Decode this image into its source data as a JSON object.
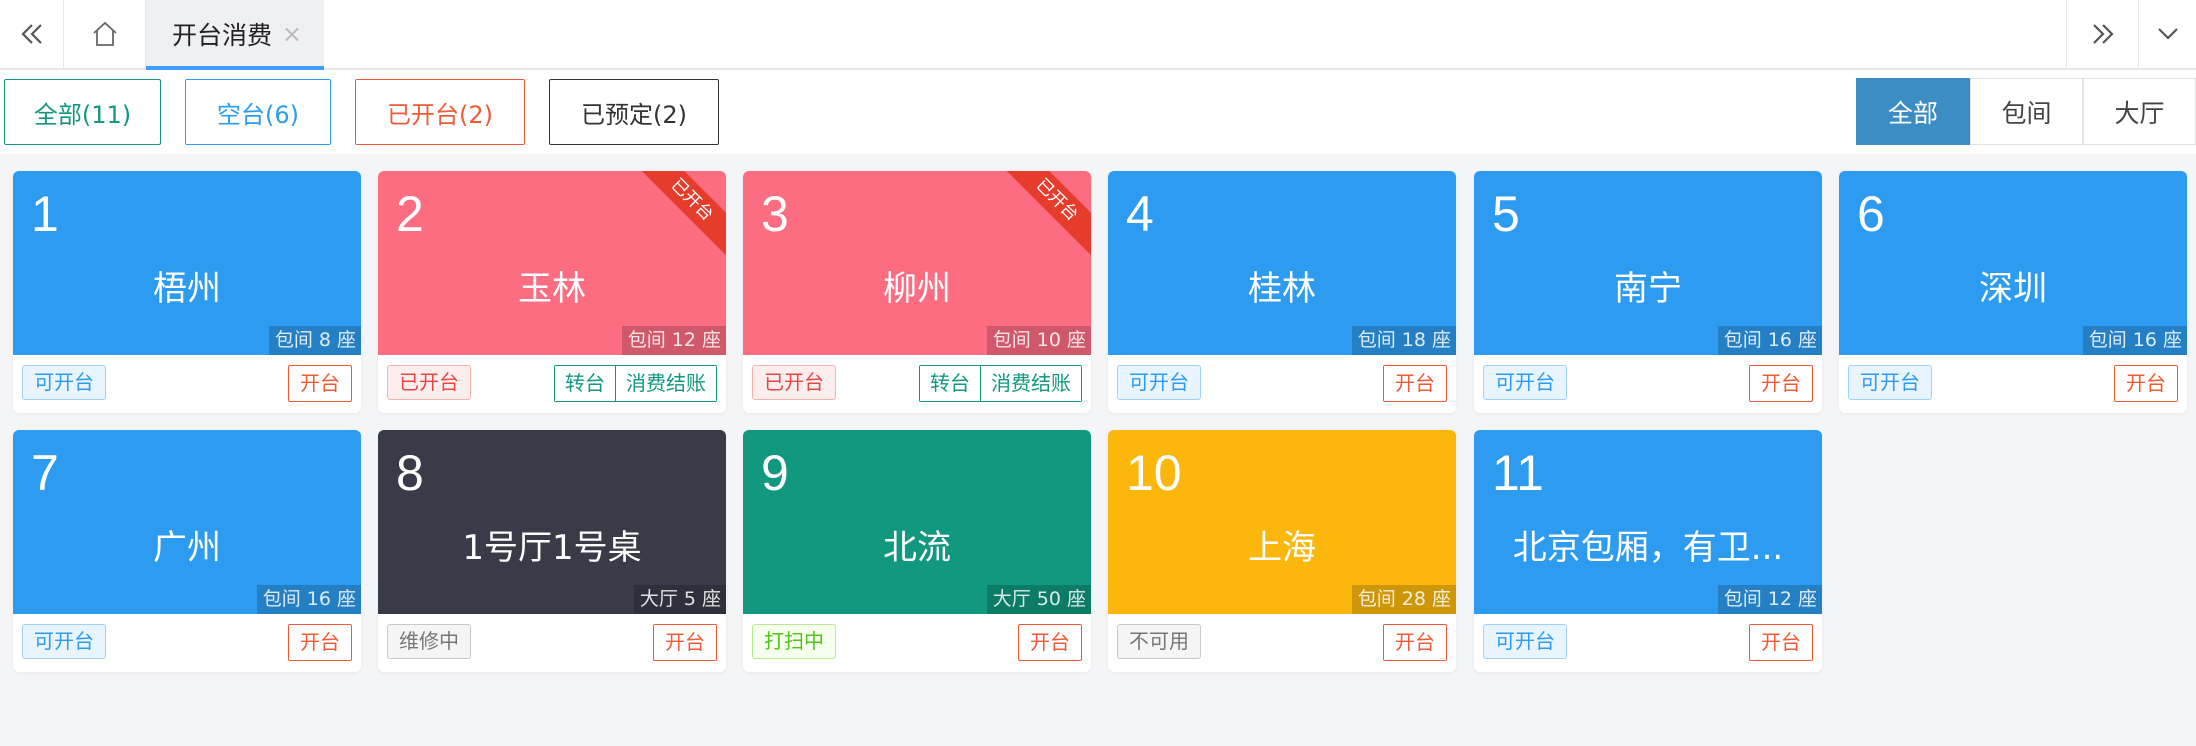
{
  "tabs": {
    "active_label": "开台消费",
    "close_symbol": "×"
  },
  "filters": [
    {
      "label": "全部(11)"
    },
    {
      "label": "空台(6)"
    },
    {
      "label": "已开台(2)"
    },
    {
      "label": "已预定(2)"
    }
  ],
  "segments": [
    {
      "label": "全部",
      "active": true
    },
    {
      "label": "包间",
      "active": false
    },
    {
      "label": "大厅",
      "active": false
    }
  ],
  "actions": {
    "open": "开台",
    "transfer": "转台",
    "checkout": "消费结账"
  },
  "ribbon_text": "已开台",
  "tables": [
    {
      "no": "1",
      "name": "梧州",
      "meta": "包间 8 座",
      "status": "可开台",
      "color": "#2d9bf0"
    },
    {
      "no": "2",
      "name": "玉林",
      "meta": "包间 12 座",
      "status": "已开台",
      "color": "#fd6d82"
    },
    {
      "no": "3",
      "name": "柳州",
      "meta": "包间 10 座",
      "status": "已开台",
      "color": "#fd6d82"
    },
    {
      "no": "4",
      "name": "桂林",
      "meta": "包间 18 座",
      "status": "可开台",
      "color": "#2d9bf0"
    },
    {
      "no": "5",
      "name": "南宁",
      "meta": "包间 16 座",
      "status": "可开台",
      "color": "#2d9bf0"
    },
    {
      "no": "6",
      "name": "深圳",
      "meta": "包间 16 座",
      "status": "可开台",
      "color": "#2d9bf0"
    },
    {
      "no": "7",
      "name": "广州",
      "meta": "包间 16 座",
      "status": "可开台",
      "color": "#2d9bf0"
    },
    {
      "no": "8",
      "name": "1号厅1号桌",
      "meta": "大厅 5 座",
      "status": "维修中",
      "color": "#393c48"
    },
    {
      "no": "9",
      "name": "北流",
      "meta": "大厅 50 座",
      "status": "打扫中",
      "color": "#11987e"
    },
    {
      "no": "10",
      "name": "上海",
      "meta": "包间 28 座",
      "status": "不可用",
      "color": "#fcb70c"
    },
    {
      "no": "11",
      "name": "北京包厢，有卫...",
      "meta": "包间 12 座",
      "status": "可开台",
      "color": "#2d9bf0"
    }
  ]
}
